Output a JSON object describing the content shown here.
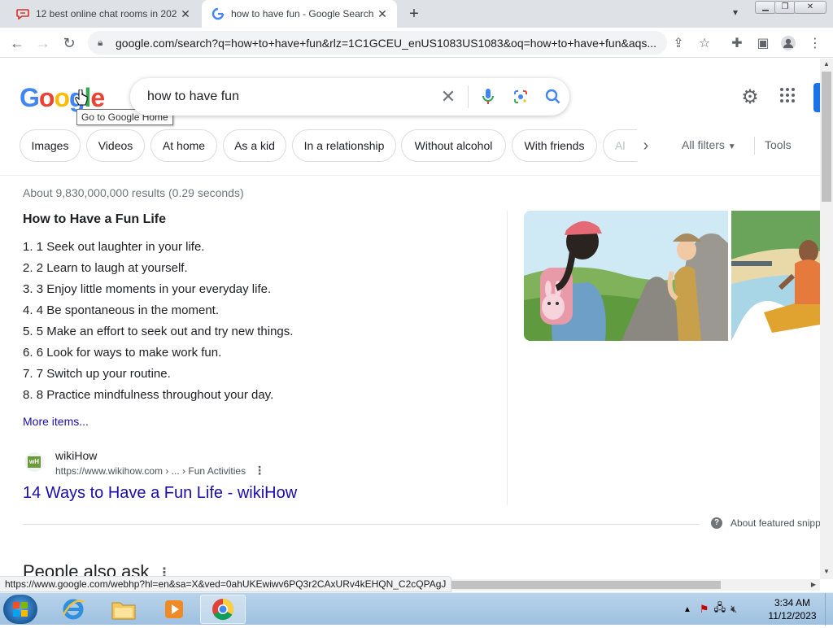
{
  "browser": {
    "tabs": [
      {
        "title": "12 best online chat rooms in 202",
        "active": false
      },
      {
        "title": "how to have fun - Google Search",
        "active": true
      }
    ],
    "new_tab_symbol": "+",
    "address": {
      "url": "google.com/search?q=how+to+have+fun&rlz=1C1GCEU_enUS1083US1083&oq=how+to+have+fun&aqs..."
    },
    "status_url": "https://www.google.com/webhp?hl=en&sa=X&ved=0ahUKEwiwv6PQ3r2CAxURv4kEHQN_C2cQPAgJ"
  },
  "google": {
    "logo_letters": [
      "G",
      "o",
      "o",
      "g",
      "l",
      "e"
    ],
    "tooltip": "Go to Google Home",
    "search": {
      "query": "how to have fun"
    },
    "chips": [
      "Images",
      "Videos",
      "At home",
      "As a kid",
      "In a relationship",
      "Without alcohol",
      "With friends",
      "Al"
    ],
    "all_filters": "All filters",
    "tools": "Tools"
  },
  "results": {
    "stats": "About 9,830,000,000 results (0.29 seconds)",
    "featured": {
      "title": "How to Have a Fun Life",
      "items": [
        "1 Seek out laughter in your life.",
        "2 Learn to laugh at yourself.",
        "3 Enjoy little moments in your everyday life.",
        "4 Be spontaneous in the moment.",
        "5 Make an effort to seek out and try new things.",
        "6 Look for ways to make work fun.",
        "7 Switch up your routine.",
        "8 Practice mindfulness throughout your day."
      ],
      "more_items": "More items...",
      "source_site": "wikiHow",
      "source_favicon_text": "wH",
      "source_url": "https://www.wikihow.com › ... › Fun Activities",
      "source_title": "14 Ways to Have a Fun Life - wikiHow",
      "about": "About featured snipp"
    },
    "people_also_ask": "People also ask"
  },
  "taskbar": {
    "time": "3:34 AM",
    "date": "11/12/2023"
  },
  "colors": {
    "link": "#1a0dab",
    "accent": "#1a73e8"
  }
}
